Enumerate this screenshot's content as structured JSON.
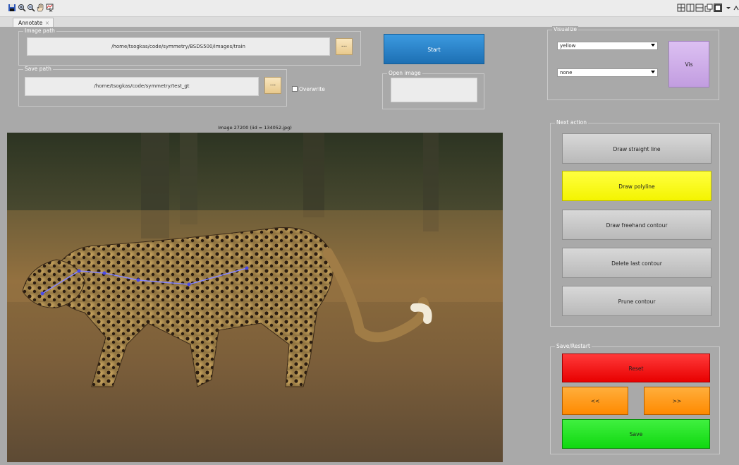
{
  "toolbar": {
    "icons": [
      "save-icon",
      "zoom-in-icon",
      "zoom-out-icon",
      "pan-icon",
      "data-cursor-icon"
    ],
    "layout_icons": [
      "grid-icon",
      "split-vertical-icon",
      "split-horizontal-icon",
      "float-icon",
      "maximize-icon",
      "dropdown-icon",
      "undock-icon"
    ]
  },
  "tab": {
    "label": "Annotate",
    "close": "×"
  },
  "image_path": {
    "title": "Image path",
    "value": "/home/tsogkas/code/symmetry/BSDS500/images/train",
    "browse": "..."
  },
  "save_path": {
    "title": "Save path",
    "value": "/home/tsogkas/code/symmetry/test_gt",
    "browse": "...",
    "overwrite_label": "Overwrite",
    "overwrite_checked": false
  },
  "start_button": "Start",
  "open_image": {
    "title": "Open image",
    "value": ""
  },
  "visualize": {
    "title": "Visualize",
    "select1": "yellow",
    "select2": "none",
    "vis_button": "Vis"
  },
  "image_caption": "Image 27200 (iid = 134052.jpg)",
  "next_action": {
    "title": "Next action",
    "buttons": [
      "Draw straight line",
      "Draw polyline",
      "Draw freehand contour",
      "Delete last contour",
      "Prune contour"
    ]
  },
  "save_restart": {
    "title": "Save/Restart",
    "reset": "Reset",
    "prev": "<<",
    "next": ">>",
    "save": "Save"
  },
  "colors": {
    "start": "#2a82c6",
    "vis": "#c9a4e6",
    "polyline": "#ffff00",
    "reset": "#ff1a1a",
    "nav": "#ff9a1a",
    "save": "#18e818",
    "annotation": "#7b7bff"
  }
}
